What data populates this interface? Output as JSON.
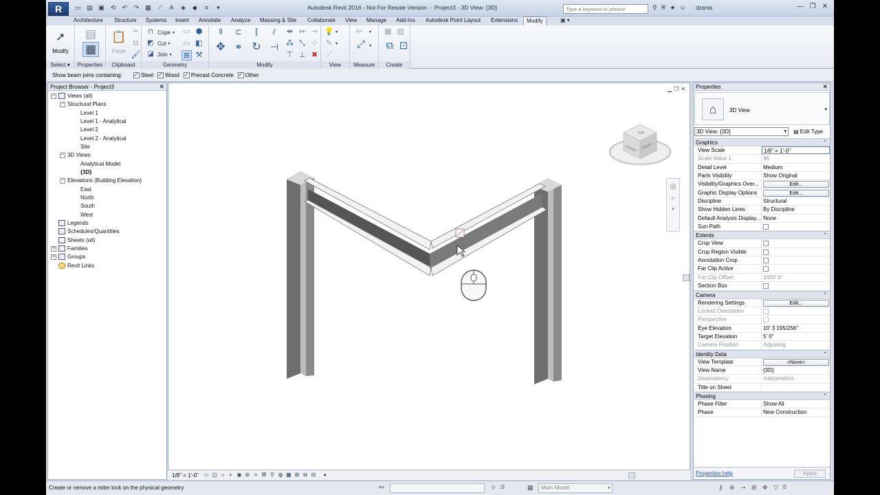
{
  "titlebar": {
    "app_button": "R",
    "title": "Autodesk Revit 2016 - Not For Resale Version",
    "separator": "-",
    "document": "Project3 - 3D View: {3D}",
    "search_placeholder": "Type a keyword or phrase",
    "user": "dzanta"
  },
  "tabs": [
    "Architecture",
    "Structure",
    "Systems",
    "Insert",
    "Annotate",
    "Analyze",
    "Massing & Site",
    "Collaborate",
    "View",
    "Manage",
    "Add-Ins",
    "Autodesk Point Layout",
    "Extensions",
    "Modify"
  ],
  "ribbon": {
    "modify_label": "Modify",
    "select_panel": "Select",
    "properties_panel": "Properties",
    "paste_label": "Paste",
    "clipboard_panel": "Clipboard",
    "cope_label": "Cope",
    "cut_label": "Cut",
    "join_label": "Join",
    "geometry_panel": "Geometry",
    "modify_panel": "Modify",
    "view_panel": "View",
    "measure_panel": "Measure",
    "create_panel": "Create"
  },
  "options_bar": {
    "label": "Show beam joins containing:",
    "options": [
      {
        "label": "Steel",
        "checked": true
      },
      {
        "label": "Wood",
        "checked": true
      },
      {
        "label": "Precast Concrete",
        "checked": true
      },
      {
        "label": "Other",
        "checked": true
      }
    ]
  },
  "project_browser": {
    "title": "Project Browser - Project3",
    "items": [
      "Views (all)",
      "Structural Plans",
      "Level 1",
      "Level 1 - Analytical",
      "Level 2",
      "Level 2 - Analytical",
      "Site",
      "3D Views",
      "Analytical Model",
      "{3D}",
      "Elevations (Building Elevation)",
      "East",
      "North",
      "South",
      "West",
      "Legends",
      "Schedules/Quantities",
      "Sheets (all)",
      "Families",
      "Groups",
      "Revit Links"
    ]
  },
  "canvas": {
    "viewcube_top": "TOP",
    "viewcube_front": "FRONT",
    "viewcube_right": "RIGHT"
  },
  "view_control": {
    "scale": "1/8\" = 1'-0\""
  },
  "properties": {
    "title": "Properties",
    "type_name": "3D View",
    "instance_selector": "3D View: {3D}",
    "edit_type": "Edit Type",
    "groups": {
      "graphics": "Graphics",
      "extents": "Extents",
      "camera": "Camera",
      "identity": "Identity Data",
      "phasing": "Phasing"
    },
    "rows": {
      "view_scale": {
        "name": "View Scale",
        "value": "1/8\" = 1'-0\""
      },
      "scale_value": {
        "name": "Scale Value    1:",
        "value": "96"
      },
      "detail_level": {
        "name": "Detail Level",
        "value": "Medium"
      },
      "parts_visibility": {
        "name": "Parts Visibility",
        "value": "Show Original"
      },
      "vg_overrides": {
        "name": "Visibility/Graphics Over...",
        "value": "Edit..."
      },
      "graphic_display": {
        "name": "Graphic Display Options",
        "value": "Edit..."
      },
      "discipline": {
        "name": "Discipline",
        "value": "Structural"
      },
      "hidden_lines": {
        "name": "Show Hidden Lines",
        "value": "By Discipline"
      },
      "analysis_display": {
        "name": "Default Analysis Display...",
        "value": "None"
      },
      "sun_path": {
        "name": "Sun Path",
        "value": ""
      },
      "crop_view": {
        "name": "Crop View",
        "value": ""
      },
      "crop_visible": {
        "name": "Crop Region Visible",
        "value": ""
      },
      "annotation_crop": {
        "name": "Annotation Crop",
        "value": ""
      },
      "far_clip_active": {
        "name": "Far Clip Active",
        "value": ""
      },
      "far_clip_offset": {
        "name": "Far Clip Offset",
        "value": "1000'  0\""
      },
      "section_box": {
        "name": "Section Box",
        "value": ""
      },
      "rendering": {
        "name": "Rendering Settings",
        "value": "Edit..."
      },
      "locked_orientation": {
        "name": "Locked Orientation",
        "value": ""
      },
      "perspective": {
        "name": "Perspective",
        "value": ""
      },
      "eye_elevation": {
        "name": "Eye Elevation",
        "value": "10'  3 195/256\""
      },
      "target_elevation": {
        "name": "Target Elevation",
        "value": "5'  0\""
      },
      "camera_position": {
        "name": "Camera Position",
        "value": "Adjusting"
      },
      "view_template": {
        "name": "View Template",
        "value": "<None>"
      },
      "view_name": {
        "name": "View Name",
        "value": "{3D}"
      },
      "dependency": {
        "name": "Dependency",
        "value": "Independent"
      },
      "title_on_sheet": {
        "name": "Title on Sheet",
        "value": ""
      },
      "phase_filter": {
        "name": "Phase Filter",
        "value": "Show All"
      },
      "phase": {
        "name": "Phase",
        "value": "New Construction"
      }
    },
    "help_link": "Properties help",
    "apply": "Apply"
  },
  "status": {
    "message": "Create or remove a miter lock on the physical geometry",
    "count": ":0",
    "model": "Main Model",
    "filter_count": ":0"
  },
  "colors": {
    "accent": "#1d3a73",
    "panel_bg": "#d6dbe9"
  }
}
